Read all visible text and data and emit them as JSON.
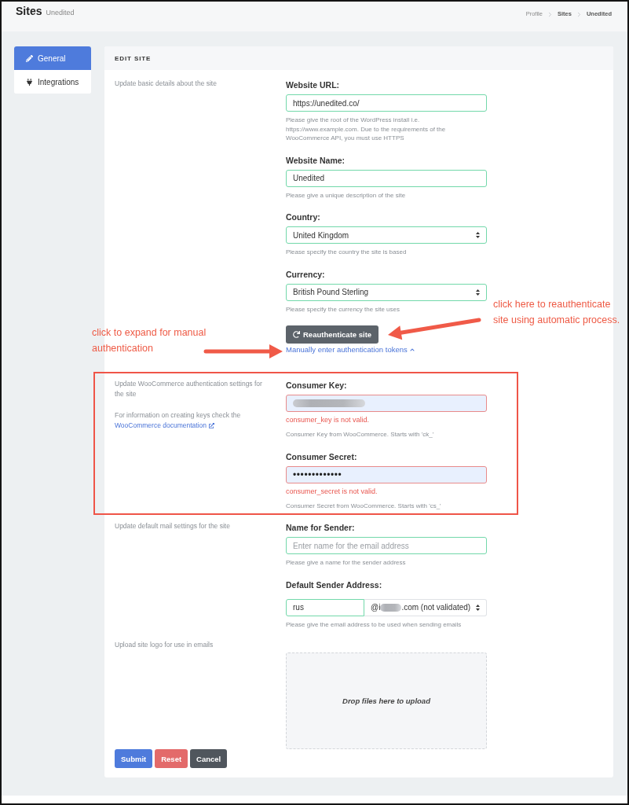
{
  "header": {
    "title": "Sites",
    "subtitle": "Unedited",
    "breadcrumb": [
      {
        "label": "Profile",
        "emphasized": false
      },
      {
        "label": "Sites",
        "emphasized": true
      },
      {
        "label": "Unedited",
        "emphasized": true
      }
    ]
  },
  "sidebar": {
    "items": [
      {
        "label": "General",
        "selected": true
      },
      {
        "label": "Integrations",
        "selected": false
      }
    ]
  },
  "card": {
    "title": "EDIT SITE",
    "sections": [
      {
        "highlighted": false,
        "description": [
          {
            "text": "Update basic details about the site"
          }
        ],
        "fields": [
          {
            "kind": "text",
            "label": "Website URL:",
            "value": "https://unedited.co/",
            "invalid": false,
            "help": "Please give the root of the WordPress install i.e. https://www.example.com. Due to the requirements of the WooCommerce API, you must use HTTPS"
          },
          {
            "kind": "text",
            "label": "Website Name:",
            "value": "Unedited",
            "invalid": false,
            "help": "Please give a unique description of the site"
          },
          {
            "kind": "select",
            "label": "Country:",
            "value": "United Kingdom",
            "invalid": false,
            "help": "Please specify the country the site is based"
          },
          {
            "kind": "select",
            "label": "Currency:",
            "value": "British Pound Sterling",
            "invalid": false,
            "help": "Please specify the currency the site uses"
          }
        ],
        "action_button": {
          "label": "Reauthenticate site"
        },
        "toggle_link": {
          "label": "Manually enter authentication tokens",
          "expanded": true
        }
      },
      {
        "highlighted": true,
        "description": [
          {
            "text": "Update WooCommerce authentication settings for the site"
          },
          {
            "text": "For information on creating keys check the",
            "link": "WooCommerce documentation"
          }
        ],
        "fields": [
          {
            "kind": "text",
            "label": "Consumer Key:",
            "redacted": true,
            "invalid": true,
            "autofilled": true,
            "error": "consumer_key is not valid.",
            "help": "Consumer Key from WooCommerce. Starts with 'ck_'"
          },
          {
            "kind": "password",
            "label": "Consumer Secret:",
            "value": "•••••••••••••",
            "invalid": true,
            "autofilled": true,
            "error": "consumer_secret is not valid.",
            "help": "Consumer Secret from WooCommerce. Starts with 'cs_'"
          }
        ]
      },
      {
        "highlighted": false,
        "description": [
          {
            "text": "Update default mail settings for the site"
          }
        ],
        "fields": [
          {
            "kind": "text",
            "label": "Name for Sender:",
            "placeholder": "Enter name for the email address",
            "invalid": false,
            "help": "Please give a name for the sender address"
          },
          {
            "kind": "split",
            "label": "Default Sender Address:",
            "value": "rus",
            "invalid": false,
            "domain": {
              "parts": [
                "@i",
                ".com (not validated)"
              ],
              "redacted": true
            },
            "help": "Please give the email address to be used when sending emails"
          }
        ]
      },
      {
        "highlighted": false,
        "description": [
          {
            "text": "Upload site logo for use in emails"
          }
        ],
        "fields": [
          {
            "kind": "dropzone",
            "text": "Drop files here to upload"
          }
        ]
      }
    ],
    "buttons": [
      {
        "label": "Submit",
        "kind": "primary"
      },
      {
        "label": "Reset",
        "kind": "danger"
      },
      {
        "label": "Cancel",
        "kind": "secondary"
      }
    ]
  },
  "annotations": [
    {
      "text": "click here to reauthenticate site using automatic process."
    },
    {
      "text": "click to expand for manual authentication"
    }
  ]
}
